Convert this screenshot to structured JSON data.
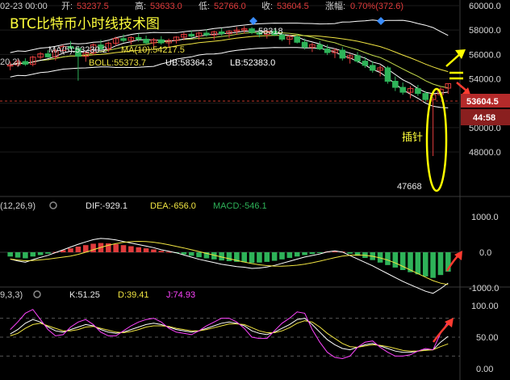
{
  "header": {
    "date": "02-23 00:00",
    "open_label": "开:",
    "open": "53237.5",
    "high_label": "高:",
    "high": "53633.0",
    "low_label": "低:",
    "low": "52766.0",
    "close_label": "收:",
    "close": "53604.5",
    "change_label": "涨幅:",
    "change": "0.70%(372.6)"
  },
  "title": "BTC比特币小时线技术图",
  "indicators": {
    "ma_prefix": "20,2)",
    "ma5": "MA(5):53230.2",
    "ma10": "MA(10):54217.5",
    "boll": "BOLL:55373.7",
    "ub": "UB:58364.3",
    "lb": "LB:52383.0",
    "macd_params": "(12,26,9)",
    "dif": "DIF:-929.1",
    "dea": "DEA:-656.0",
    "macd": "MACD:-546.1",
    "kdj_params": "9,3,3)",
    "k": "K:51.25",
    "d": "D:39.41",
    "j": "J:74.93"
  },
  "annotations": {
    "peak_label": "58318",
    "low_label": "47668",
    "wick_label": "插针",
    "price_tag": "53604.5",
    "countdown": "44:58"
  },
  "axis": {
    "main_ticks": [
      "60000.0",
      "58000.0",
      "56000.0",
      "54000.0",
      "52000.0",
      "50000.0",
      "48000.0"
    ],
    "macd_ticks": [
      "1000.0",
      "0.0",
      "-1000.0"
    ],
    "kdj_ticks": [
      "100.00",
      "50.00",
      "0.00"
    ]
  },
  "colors": {
    "up": "#e03c3c",
    "down": "#2eb359",
    "ma5": "#ffffff",
    "ma10": "#f0e442",
    "boll": "#f0e442",
    "bands": "#ffffff",
    "k_line": "#ffffff",
    "d_line": "#f0e442",
    "j_line": "#ff44ff",
    "annotation": "#ffff00",
    "arrow": "#ff3b30",
    "price_line": "#e03c3c"
  },
  "chart_data": [
    {
      "type": "candlestick",
      "title": "BTC比特币小时线技术图",
      "ylim": [
        47000,
        60500
      ],
      "y_ticks": [
        48000,
        50000,
        52000,
        54000,
        56000,
        58000,
        60000
      ],
      "grid": true,
      "candles": [
        [
          55050,
          55420,
          54700,
          55150
        ],
        [
          55150,
          55580,
          54980,
          55420
        ],
        [
          55420,
          55680,
          55060,
          55200
        ],
        [
          55200,
          55900,
          55030,
          55780
        ],
        [
          55780,
          56200,
          55600,
          56050
        ],
        [
          56050,
          56350,
          55720,
          55800
        ],
        [
          55800,
          56450,
          55500,
          56320
        ],
        [
          56320,
          56800,
          56100,
          56650
        ],
        [
          56650,
          57100,
          56420,
          56500
        ],
        [
          56500,
          56700,
          53850,
          55850
        ],
        [
          55850,
          56300,
          55400,
          56120
        ],
        [
          56120,
          56900,
          55950,
          56780
        ],
        [
          56780,
          57200,
          56380,
          56450
        ],
        [
          56450,
          57050,
          56200,
          56920
        ],
        [
          56920,
          57450,
          56700,
          57300
        ],
        [
          57300,
          57650,
          57000,
          57150
        ],
        [
          57150,
          57500,
          56800,
          57380
        ],
        [
          57380,
          57700,
          57050,
          57250
        ],
        [
          57250,
          57550,
          56800,
          56950
        ],
        [
          56950,
          57350,
          56500,
          57200
        ],
        [
          57200,
          57500,
          56800,
          56950
        ],
        [
          56950,
          57300,
          56600,
          57150
        ],
        [
          57150,
          57500,
          56900,
          57420
        ],
        [
          57420,
          57800,
          57150,
          57650
        ],
        [
          57650,
          57950,
          57350,
          57500
        ],
        [
          57500,
          57850,
          57200,
          57750
        ],
        [
          57750,
          58050,
          57450,
          57600
        ],
        [
          57600,
          57950,
          57200,
          57850
        ],
        [
          57850,
          58150,
          57550,
          57700
        ],
        [
          57700,
          58000,
          57350,
          57900
        ],
        [
          57900,
          58250,
          57600,
          58000
        ],
        [
          58000,
          58318,
          57700,
          58100
        ],
        [
          58100,
          58250,
          57650,
          57800
        ],
        [
          57800,
          58100,
          57400,
          57650
        ],
        [
          57650,
          58000,
          57300,
          57900
        ],
        [
          57900,
          58150,
          57500,
          57600
        ],
        [
          57600,
          57900,
          57100,
          57250
        ],
        [
          57250,
          57600,
          56800,
          57450
        ],
        [
          57450,
          57650,
          56900,
          57000
        ],
        [
          57000,
          57300,
          56400,
          56600
        ],
        [
          56600,
          56950,
          56200,
          56800
        ],
        [
          56800,
          57100,
          56350,
          56450
        ],
        [
          56450,
          56800,
          55950,
          56150
        ],
        [
          56150,
          56500,
          55700,
          56350
        ],
        [
          56350,
          56600,
          55500,
          55700
        ],
        [
          55700,
          56050,
          55250,
          55900
        ],
        [
          55900,
          56200,
          55300,
          55450
        ],
        [
          55450,
          55800,
          54900,
          55100
        ],
        [
          55100,
          55450,
          54500,
          54700
        ],
        [
          54700,
          55100,
          54200,
          54900
        ],
        [
          54900,
          55050,
          53600,
          53800
        ],
        [
          53800,
          54200,
          53000,
          53300
        ],
        [
          53300,
          53700,
          52700,
          52900
        ],
        [
          52900,
          53400,
          52400,
          53200
        ],
        [
          53200,
          53500,
          52600,
          52800
        ],
        [
          52800,
          53000,
          52100,
          52300
        ],
        [
          52300,
          52500,
          47668,
          52700
        ],
        [
          52700,
          53300,
          52500,
          53150
        ],
        [
          53237.5,
          53633,
          52766,
          53604.5
        ]
      ],
      "series": [
        {
          "name": "MA(5)",
          "last": 53230.2
        },
        {
          "name": "MA(10)",
          "last": 54217.5
        },
        {
          "name": "BOLL",
          "last": 55373.7
        },
        {
          "name": "UB",
          "last": 58364.3
        },
        {
          "name": "LB",
          "last": 52383.0
        }
      ],
      "annotations": {
        "high": 58318,
        "low": 47668,
        "last_price": 53604.5
      }
    },
    {
      "type": "bar",
      "title": "MACD(12,26,9)",
      "ylim": [
        -1500,
        1500
      ],
      "y_ticks": [
        1000,
        0,
        -1000
      ],
      "histogram": [
        -120,
        -150,
        -170,
        -120,
        -80,
        -40,
        10,
        60,
        110,
        160,
        200,
        240,
        260,
        250,
        230,
        200,
        170,
        140,
        110,
        80,
        40,
        10,
        -20,
        -60,
        -100,
        -140,
        -170,
        -200,
        -230,
        -250,
        -270,
        -280,
        -300,
        -290,
        -270,
        -240,
        -200,
        -160,
        -120,
        -80,
        -50,
        -20,
        20,
        40,
        20,
        -40,
        -100,
        -160,
        -220,
        -290,
        -360,
        -430,
        -500,
        -560,
        -620,
        -680,
        -720,
        -640,
        -546
      ],
      "series": [
        {
          "name": "DIF",
          "last": -929.1
        },
        {
          "name": "DEA",
          "last": -656.0
        },
        {
          "name": "MACD",
          "last": -546.1
        }
      ]
    },
    {
      "type": "line",
      "title": "KDJ(9,3,3)",
      "ylim": [
        -10,
        110
      ],
      "y_ticks": [
        100,
        50,
        0
      ],
      "series": [
        {
          "name": "K",
          "values": [
            55,
            62,
            72,
            78,
            74,
            66,
            60,
            58,
            62,
            66,
            70,
            68,
            62,
            58,
            56,
            58,
            62,
            66,
            70,
            72,
            70,
            66,
            62,
            60,
            58,
            60,
            64,
            68,
            72,
            74,
            72,
            68,
            60,
            56,
            54,
            58,
            64,
            70,
            78,
            80,
            70,
            58,
            46,
            38,
            32,
            30,
            34,
            38,
            40,
            36,
            32,
            28,
            26,
            26,
            28,
            30,
            30,
            42,
            51.25
          ]
        },
        {
          "name": "D",
          "values": [
            52,
            56,
            64,
            70,
            72,
            68,
            64,
            60,
            60,
            62,
            66,
            67,
            64,
            61,
            58,
            57,
            59,
            62,
            66,
            68,
            68,
            67,
            64,
            62,
            60,
            60,
            62,
            65,
            68,
            71,
            71,
            70,
            65,
            60,
            57,
            57,
            60,
            65,
            72,
            76,
            74,
            66,
            56,
            48,
            40,
            35,
            34,
            36,
            38,
            37,
            35,
            32,
            29,
            28,
            28,
            29,
            30,
            35,
            39.41
          ]
        },
        {
          "name": "J",
          "values": [
            62,
            74,
            88,
            94,
            78,
            62,
            52,
            54,
            66,
            74,
            78,
            70,
            58,
            52,
            52,
            60,
            68,
            74,
            78,
            80,
            74,
            64,
            58,
            56,
            54,
            60,
            68,
            74,
            80,
            80,
            74,
            64,
            50,
            48,
            48,
            60,
            72,
            80,
            90,
            88,
            62,
            42,
            26,
            18,
            16,
            20,
            34,
            42,
            44,
            34,
            26,
            20,
            20,
            22,
            28,
            32,
            30,
            56,
            74.93
          ]
        }
      ]
    }
  ]
}
